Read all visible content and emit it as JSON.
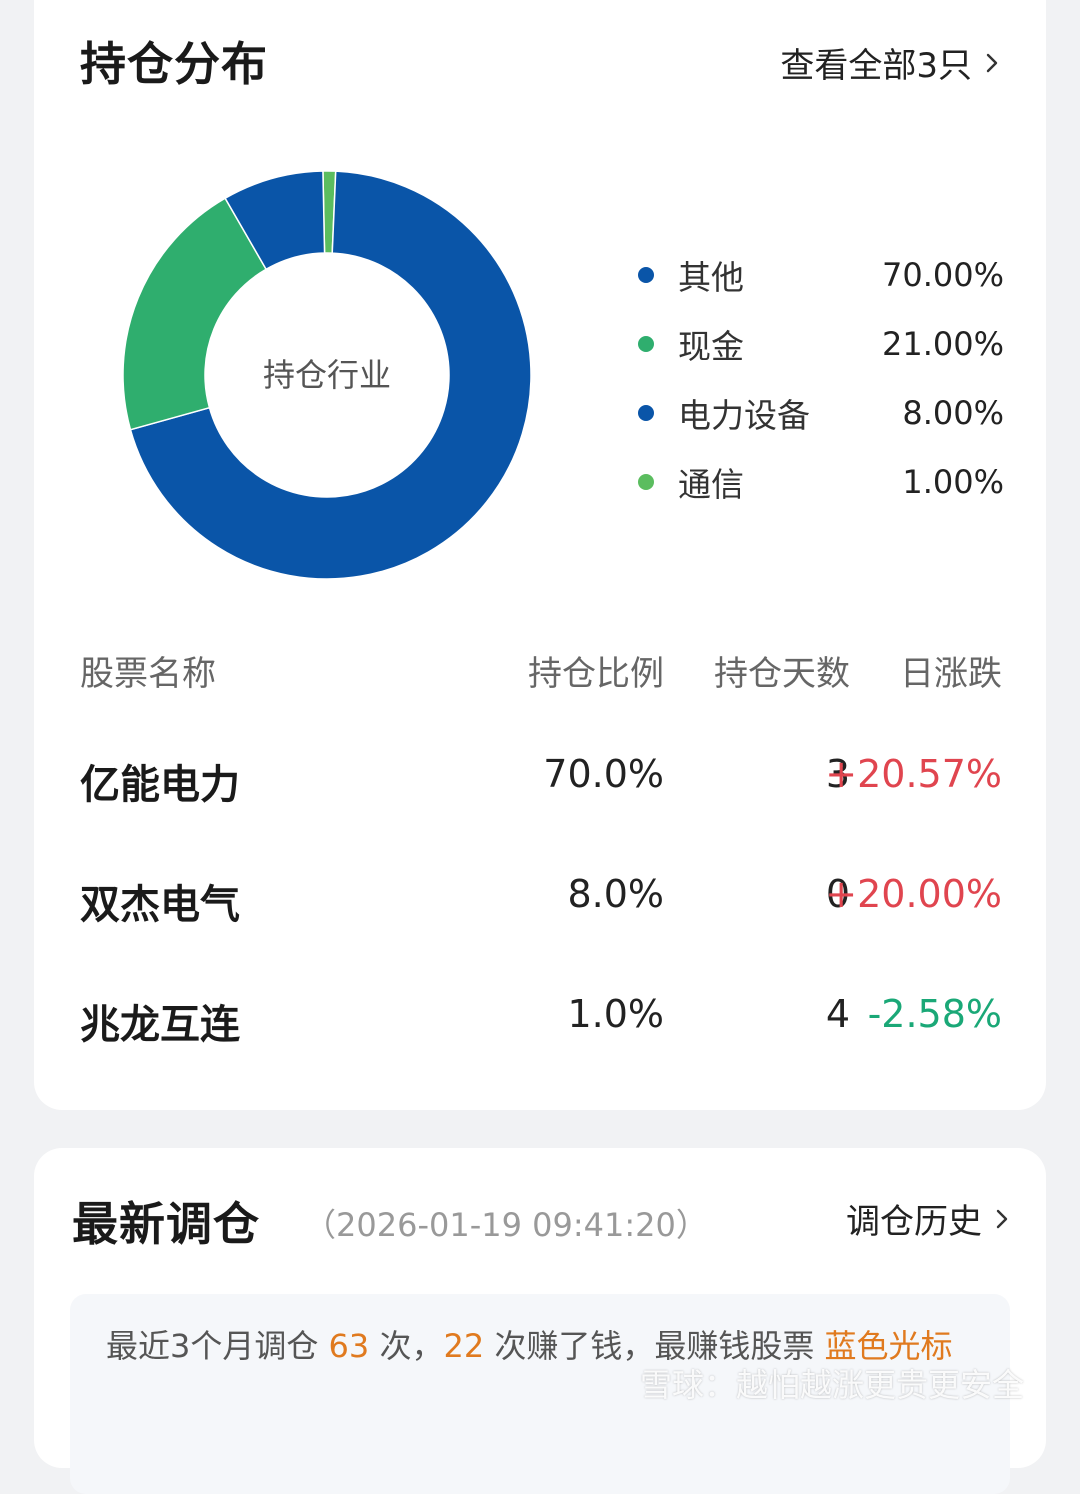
{
  "holdings": {
    "title": "持仓分布",
    "view_all": "查看全部3只",
    "donut_center": "持仓行业",
    "legend": [
      {
        "name": "其他",
        "value": "70.00%",
        "color": "#0a55a8",
        "pct": 70
      },
      {
        "name": "现金",
        "value": "21.00%",
        "color": "#2fae6e",
        "pct": 21
      },
      {
        "name": "电力设备",
        "value": "8.00%",
        "color": "#0a55a8",
        "pct": 8
      },
      {
        "name": "通信",
        "value": "1.00%",
        "color": "#5bbd5f",
        "pct": 1
      }
    ],
    "table": {
      "headers": {
        "name": "股票名称",
        "ratio": "持仓比例",
        "days": "持仓天数",
        "change": "日涨跌"
      },
      "rows": [
        {
          "name": "亿能电力",
          "ratio": "70.0%",
          "days": "3",
          "change": "+20.57%",
          "trend": "up"
        },
        {
          "name": "双杰电气",
          "ratio": "8.0%",
          "days": "0",
          "change": "+20.00%",
          "trend": "up"
        },
        {
          "name": "兆龙互连",
          "ratio": "1.0%",
          "days": "4",
          "change": "-2.58%",
          "trend": "down"
        }
      ]
    }
  },
  "rebalance": {
    "title": "最新调仓",
    "timestamp": "（2026-01-19 09:41:20）",
    "history_link": "调仓历史",
    "notice": {
      "prefix": "最近3个月调仓 ",
      "count": "63",
      "mid1": " 次，",
      "profit_count": "22",
      "mid2": " 次赚了钱，最赚钱股票 ",
      "best_stock": "蓝色光标"
    }
  },
  "watermark": "雪球：越怕越涨更贵更安全",
  "colors": {
    "up": "#e0454f",
    "down": "#1aa877",
    "highlight": "#e07a1f"
  }
}
